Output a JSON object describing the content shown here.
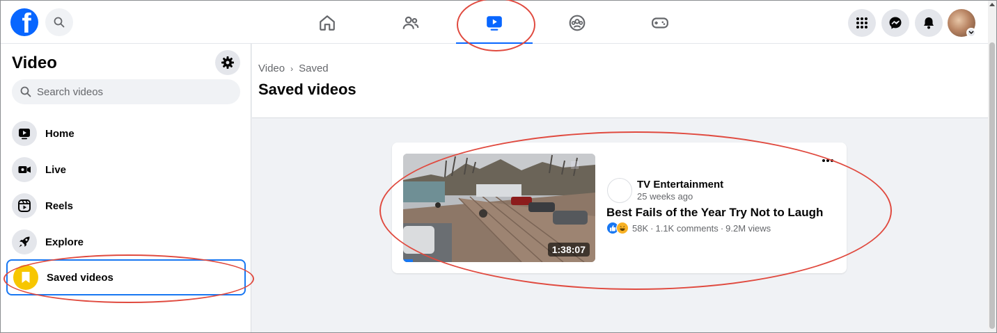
{
  "topbar": {
    "logo_letter": "f",
    "nav_tabs": [
      {
        "name": "home",
        "icon": "home-icon"
      },
      {
        "name": "friends",
        "icon": "friends-icon"
      },
      {
        "name": "video",
        "icon": "video-icon",
        "active": true
      },
      {
        "name": "groups",
        "icon": "groups-icon"
      },
      {
        "name": "gaming",
        "icon": "gaming-icon"
      }
    ],
    "right_icons": [
      "menu-grid-icon",
      "messenger-icon",
      "bell-icon"
    ]
  },
  "sidebar": {
    "title": "Video",
    "search_placeholder": "Search videos",
    "items": [
      {
        "label": "Home",
        "icon": "video-home-icon"
      },
      {
        "label": "Live",
        "icon": "live-camera-icon"
      },
      {
        "label": "Reels",
        "icon": "reels-icon"
      },
      {
        "label": "Explore",
        "icon": "rocket-icon"
      },
      {
        "label": "Saved videos",
        "icon": "bookmark-icon",
        "active": true
      }
    ]
  },
  "main": {
    "breadcrumb": [
      "Video",
      "Saved"
    ],
    "title": "Saved videos",
    "video": {
      "channel": "TV Entertainment",
      "time": "25 weeks ago",
      "title": "Best Fails of the Year Try Not to Laugh",
      "duration": "1:38:07",
      "watched_fraction": 0.05,
      "reactions_count": "58K",
      "comments": "1.1K comments",
      "views": "9.2M views"
    }
  },
  "colors": {
    "brand": "#0866ff",
    "annotation": "#e04a3f",
    "saved_icon_bg": "#f7c600"
  }
}
